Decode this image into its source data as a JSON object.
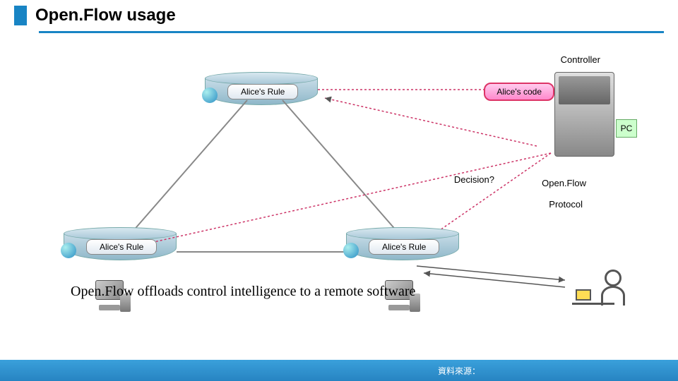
{
  "header": {
    "title": "Open.Flow usage"
  },
  "labels": {
    "controller": "Controller",
    "pc": "PC",
    "decision": "Decision?",
    "openflow": "Open.Flow",
    "protocol": "Protocol"
  },
  "nodes": {
    "top_switch": {
      "rule": "Alice's Rule"
    },
    "left_switch": {
      "rule": "Alice's Rule"
    },
    "right_switch": {
      "rule": "Alice's Rule"
    },
    "controller": {
      "code": "Alice's code"
    }
  },
  "statement": "Open.Flow offloads control intelligence to a remote software",
  "footer": {
    "source": "資料來源："
  }
}
